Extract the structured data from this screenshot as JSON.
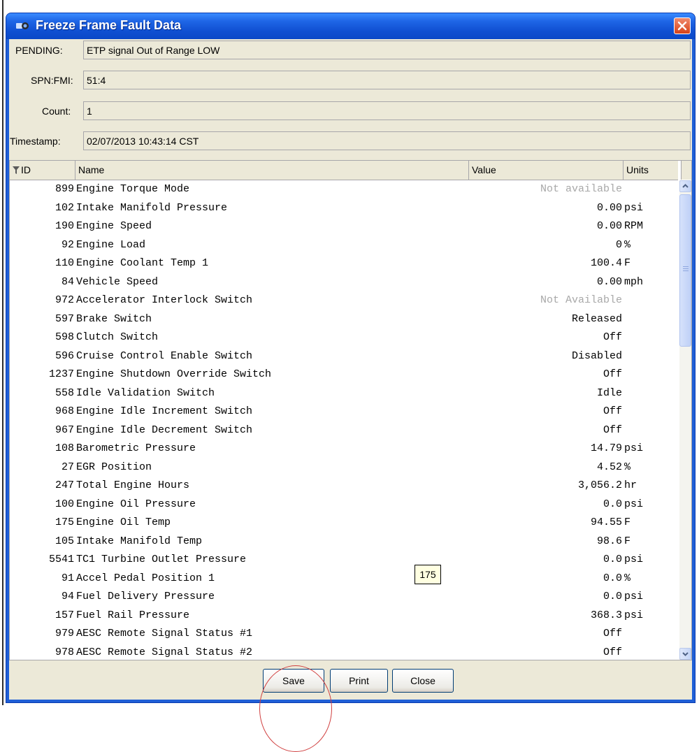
{
  "window": {
    "title": "Freeze Frame Fault Data"
  },
  "fields": {
    "pending_label": "PENDING:",
    "pending_value": "ETP signal Out of Range LOW",
    "spnfmi_label": "SPN:FMI:",
    "spnfmi_value": "51:4",
    "count_label": "Count:",
    "count_value": "1",
    "timestamp_label": "Timestamp:",
    "timestamp_value": "02/07/2013 10:43:14 CST"
  },
  "table": {
    "columns": {
      "id": "ID",
      "name": "Name",
      "value": "Value",
      "units": "Units"
    },
    "rows": [
      {
        "id": "899",
        "name": "Engine Torque Mode",
        "value": "Not available",
        "units": ""
      },
      {
        "id": "102",
        "name": "Intake Manifold Pressure",
        "value": "0.00",
        "units": "psi"
      },
      {
        "id": "190",
        "name": "Engine Speed",
        "value": "0.00",
        "units": "RPM"
      },
      {
        "id": "92",
        "name": "Engine Load",
        "value": "0",
        "units": "%"
      },
      {
        "id": "110",
        "name": "Engine Coolant Temp 1",
        "value": "100.4",
        "units": "F"
      },
      {
        "id": "84",
        "name": "Vehicle Speed",
        "value": "0.00",
        "units": "mph"
      },
      {
        "id": "972",
        "name": "Accelerator Interlock Switch",
        "value": "Not Available",
        "units": ""
      },
      {
        "id": "597",
        "name": "Brake Switch",
        "value": "Released",
        "units": ""
      },
      {
        "id": "598",
        "name": "Clutch Switch",
        "value": "Off",
        "units": ""
      },
      {
        "id": "596",
        "name": "Cruise Control Enable Switch",
        "value": "Disabled",
        "units": ""
      },
      {
        "id": "1237",
        "name": "Engine Shutdown Override Switch",
        "value": "Off",
        "units": ""
      },
      {
        "id": "558",
        "name": "Idle Validation Switch",
        "value": "Idle",
        "units": ""
      },
      {
        "id": "968",
        "name": "Engine Idle Increment Switch",
        "value": "Off",
        "units": ""
      },
      {
        "id": "967",
        "name": "Engine Idle Decrement Switch",
        "value": "Off",
        "units": ""
      },
      {
        "id": "108",
        "name": "Barometric Pressure",
        "value": "14.79",
        "units": "psi"
      },
      {
        "id": "27",
        "name": "EGR Position",
        "value": "4.52",
        "units": "%"
      },
      {
        "id": "247",
        "name": "Total Engine Hours",
        "value": "3,056.2",
        "units": "hr"
      },
      {
        "id": "100",
        "name": "Engine Oil Pressure",
        "value": "0.0",
        "units": "psi"
      },
      {
        "id": "175",
        "name": "Engine Oil Temp",
        "value": "94.55",
        "units": "F"
      },
      {
        "id": "105",
        "name": "Intake Manifold Temp",
        "value": "98.6",
        "units": "F"
      },
      {
        "id": "5541",
        "name": "TC1 Turbine Outlet Pressure",
        "value": "0.0",
        "units": "psi"
      },
      {
        "id": "91",
        "name": "Accel Pedal Position 1",
        "value": "0.0",
        "units": "%"
      },
      {
        "id": "94",
        "name": "Fuel Delivery Pressure",
        "value": "0.0",
        "units": "psi"
      },
      {
        "id": "157",
        "name": "Fuel Rail Pressure",
        "value": "368.3",
        "units": "psi"
      },
      {
        "id": "979",
        "name": "AESC Remote Signal Status #1",
        "value": "Off",
        "units": ""
      },
      {
        "id": "978",
        "name": "AESC Remote Signal Status #2",
        "value": "Off",
        "units": ""
      }
    ]
  },
  "tooltip": "175",
  "buttons": {
    "save": "Save",
    "print": "Print",
    "close": "Close"
  },
  "colors": {
    "titlebar": "#0a48c7",
    "dialog_bg": "#ece9d8",
    "muted_text": "#a8a8a8",
    "annotation": "#d04040"
  }
}
